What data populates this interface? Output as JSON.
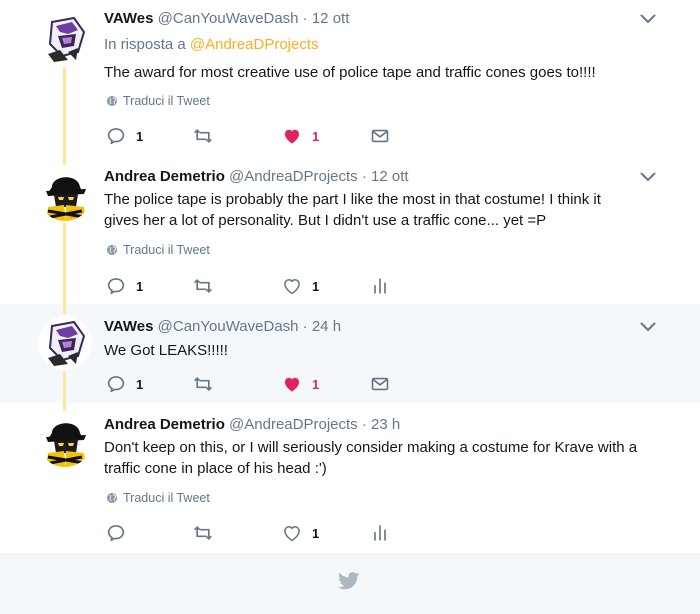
{
  "tweets": [
    {
      "name": "VAWes",
      "handle": "@CanYouWaveDash",
      "dot": "·",
      "time": "12 ott",
      "reply_prefix": "In risposta a",
      "reply_to": "@AndreaDProjects",
      "text": "The award for most creative use of police tape and traffic cones goes to!!!!",
      "translate": "Traduci il Tweet",
      "replies": "1",
      "likes": "1"
    },
    {
      "name": "Andrea Demetrio",
      "handle": "@AndreaDProjects",
      "dot": "·",
      "time": "12 ott",
      "text_lines": [
        "The police tape is probably the part I like the most in that costume! I think it",
        "gives her a lot of personality. But I didn't use a traffic cone... yet =P"
      ],
      "translate": "Traduci il Tweet",
      "replies": "1",
      "likes": "1"
    },
    {
      "name": "VAWes",
      "handle": "@CanYouWaveDash",
      "dot": "·",
      "time": "24 h",
      "text": "We Got LEAKS!!!!!",
      "replies": "1",
      "likes": "1"
    },
    {
      "name": "Andrea Demetrio",
      "handle": "@AndreaDProjects",
      "dot": "·",
      "time": "23 h",
      "text_lines": [
        "Don't keep on this, or I will seriously consider making a costume for Krave with a",
        "traffic cone in place of his head :')"
      ],
      "translate": "Traduci il Tweet",
      "likes": "1"
    }
  ],
  "colors": {
    "accent_link": "#ffad1f",
    "like_active": "#e0245e",
    "thread_line": "#ffe59a",
    "muted": "#657786",
    "highlight_bg": "#f5f8fa"
  },
  "icons": {
    "reply": "reply-icon",
    "retweet": "retweet-icon",
    "like": "heart-icon",
    "dm": "envelope-icon",
    "analytics": "analytics-icon",
    "translate": "globe-icon",
    "more": "chevron-down-icon",
    "footer": "twitter-bird-icon"
  }
}
